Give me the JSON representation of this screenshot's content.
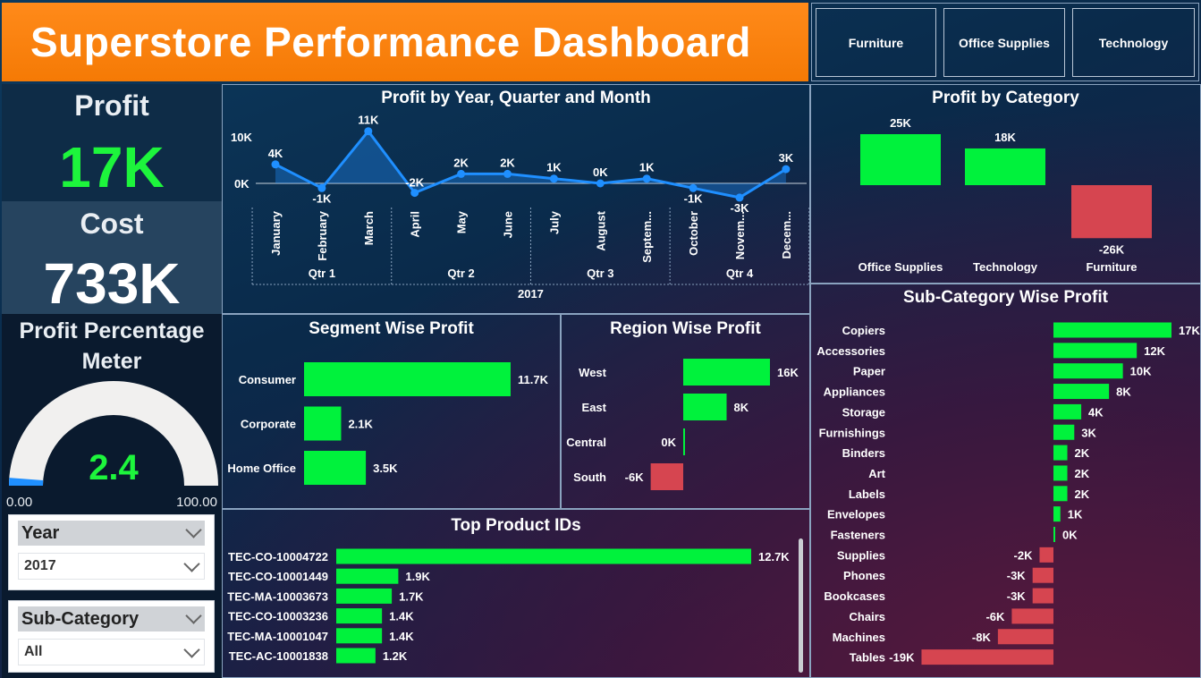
{
  "title": "Superstore Performance Dashboard",
  "category_slicer": [
    "Furniture",
    "Office Supplies",
    "Technology"
  ],
  "kpis": {
    "profit_label": "Profit",
    "profit_value": "17K",
    "cost_label": "Cost",
    "cost_value": "733K"
  },
  "gauge": {
    "title_line1": "Profit Percentage",
    "title_line2": "Meter",
    "value_label": "2.4",
    "value": 2.4,
    "min": 0,
    "max": 100,
    "min_label": "0.00",
    "max_label": "100.00"
  },
  "filters": {
    "year": {
      "label": "Year",
      "value": "2017"
    },
    "subcategory": {
      "label": "Sub-Category",
      "value": "All"
    }
  },
  "colors": {
    "positive": "#00f23c",
    "negative": "#d64550",
    "line": "#1f8fff",
    "title_bg": "#f57a05"
  },
  "chart_data": [
    {
      "id": "profit_by_month",
      "type": "line",
      "title": "Profit by Year, Quarter and Month",
      "categories": [
        "January",
        "February",
        "March",
        "April",
        "May",
        "June",
        "July",
        "August",
        "Septem...",
        "October",
        "Novem...",
        "Decem..."
      ],
      "values": [
        4,
        -1,
        11,
        -2,
        2,
        2,
        1,
        0,
        1,
        -1,
        -3,
        3
      ],
      "labels": [
        "4K",
        "-1K",
        "11K",
        "-2K",
        "2K",
        "2K",
        "1K",
        "0K",
        "1K",
        "-1K",
        "-3K",
        "3K"
      ],
      "quarters": [
        "Qtr 1",
        "Qtr 2",
        "Qtr 3",
        "Qtr 4"
      ],
      "year": "2017",
      "yticks": [
        "10K",
        "0K"
      ],
      "ylim": [
        -3,
        11
      ]
    },
    {
      "id": "profit_by_category",
      "type": "bar",
      "title": "Profit by Category",
      "categories": [
        "Office Supplies",
        "Technology",
        "Furniture"
      ],
      "values": [
        25,
        18,
        -26
      ],
      "labels": [
        "25K",
        "18K",
        "-26K"
      ]
    },
    {
      "id": "segment_profit",
      "type": "bar",
      "title": "Segment Wise Profit",
      "categories": [
        "Consumer",
        "Corporate",
        "Home Office"
      ],
      "values": [
        11.7,
        2.1,
        3.5
      ],
      "labels": [
        "11.7K",
        "2.1K",
        "3.5K"
      ]
    },
    {
      "id": "region_profit",
      "type": "bar",
      "title": "Region Wise Profit",
      "categories": [
        "West",
        "East",
        "Central",
        "South"
      ],
      "values": [
        16,
        8,
        0,
        -6
      ],
      "labels": [
        "16K",
        "8K",
        "0K",
        "-6K"
      ]
    },
    {
      "id": "top_products",
      "type": "bar",
      "title": "Top Product IDs",
      "categories": [
        "TEC-CO-10004722",
        "TEC-CO-10001449",
        "TEC-MA-10003673",
        "TEC-CO-10003236",
        "TEC-MA-10001047",
        "TEC-AC-10001838"
      ],
      "values": [
        12.7,
        1.9,
        1.7,
        1.4,
        1.4,
        1.2
      ],
      "labels": [
        "12.7K",
        "1.9K",
        "1.7K",
        "1.4K",
        "1.4K",
        "1.2K"
      ]
    },
    {
      "id": "subcategory_profit",
      "type": "bar",
      "title": "Sub-Category Wise Profit",
      "categories": [
        "Copiers",
        "Accessories",
        "Paper",
        "Appliances",
        "Storage",
        "Furnishings",
        "Binders",
        "Art",
        "Labels",
        "Envelopes",
        "Fasteners",
        "Supplies",
        "Phones",
        "Bookcases",
        "Chairs",
        "Machines",
        "Tables"
      ],
      "values": [
        17,
        12,
        10,
        8,
        4,
        3,
        2,
        2,
        2,
        1,
        0,
        -2,
        -3,
        -3,
        -6,
        -8,
        -19
      ],
      "labels": [
        "17K",
        "12K",
        "10K",
        "8K",
        "4K",
        "3K",
        "2K",
        "2K",
        "2K",
        "1K",
        "0K",
        "-2K",
        "-3K",
        "-3K",
        "-6K",
        "-8K",
        "-19K"
      ]
    }
  ]
}
